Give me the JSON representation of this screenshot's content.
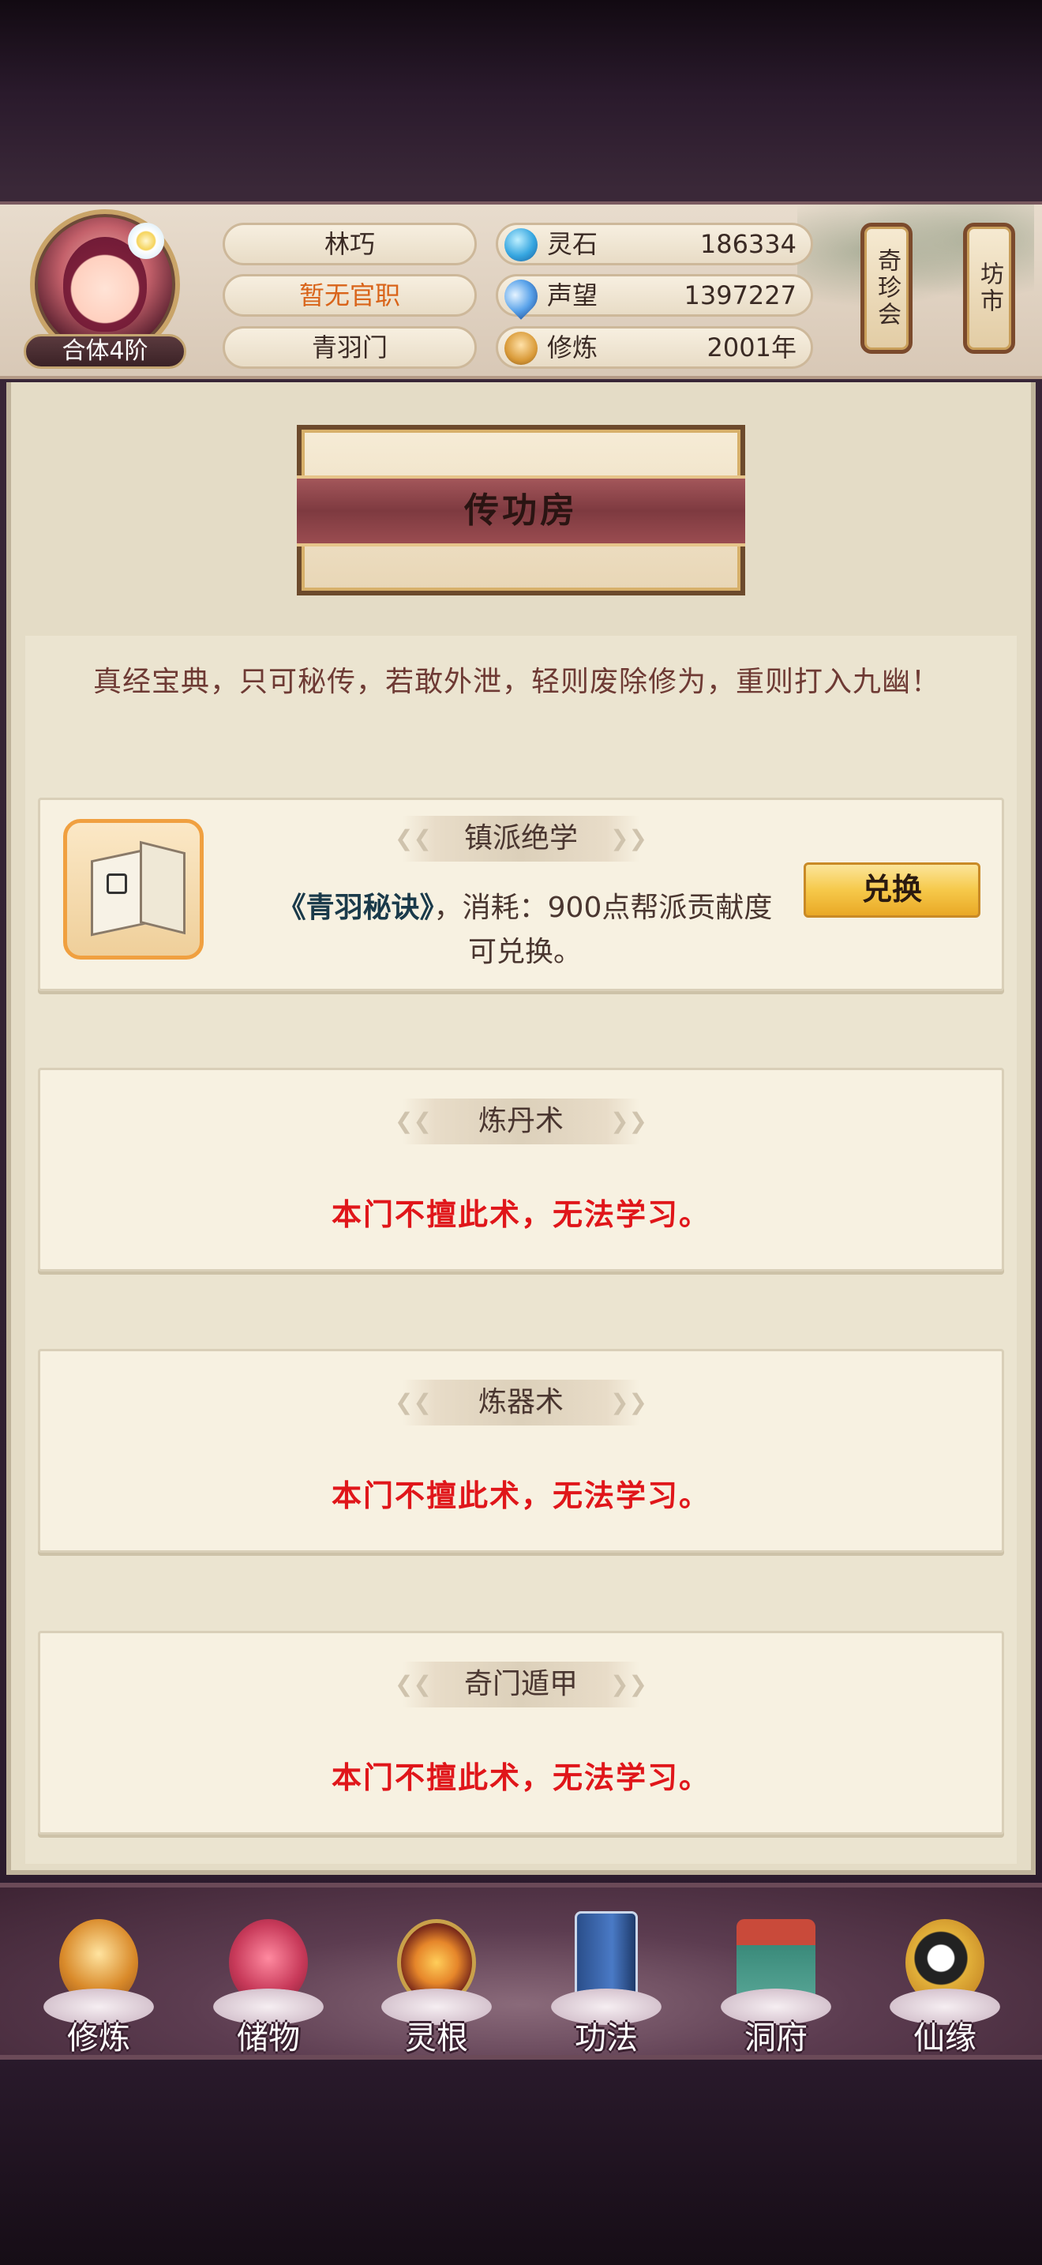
{
  "player": {
    "name": "林巧",
    "rank_badge": "合体4阶",
    "official_title": "暂无官职",
    "sect": "青羽门"
  },
  "resources": [
    {
      "icon": "spirit-stone-icon",
      "label": "灵石",
      "value": "186334"
    },
    {
      "icon": "fame-icon",
      "label": "声望",
      "value": "1397227"
    },
    {
      "icon": "cultivation-icon",
      "label": "修炼",
      "value": "2001年"
    }
  ],
  "side_buttons": {
    "treasure_hall": "奇珍会",
    "market": "坊市"
  },
  "page": {
    "title": "传功房",
    "intro": "真经宝典，只可秘传，若敢外泄，轻则废除修为，重则打入九幽！"
  },
  "cards": {
    "featured": {
      "title": "镇派绝学",
      "technique_name": "《青羽秘诀》",
      "description": "，消耗：900点帮派贡献度可兑换。",
      "button": "兑换"
    },
    "alchemy": {
      "title": "炼丹术",
      "message": "本门不擅此术，无法学习。"
    },
    "crafting": {
      "title": "炼器术",
      "message": "本门不擅此术，无法学习。"
    },
    "qimen": {
      "title": "奇门遁甲",
      "message": "本门不擅此术，无法学习。"
    }
  },
  "bottom_nav": [
    {
      "label": "修炼",
      "icon": "cultivation-nav-icon"
    },
    {
      "label": "储物",
      "icon": "storage-bag-icon"
    },
    {
      "label": "灵根",
      "icon": "spirit-root-icon"
    },
    {
      "label": "功法",
      "icon": "technique-book-icon"
    },
    {
      "label": "洞府",
      "icon": "cave-dwelling-icon"
    },
    {
      "label": "仙缘",
      "icon": "immortal-fate-icon"
    }
  ],
  "colors": {
    "accent_red": "#e0161a",
    "rank_orange": "#d9641a",
    "panel_bg": "#e4dcc6",
    "button_gold": "#f6c94a"
  }
}
